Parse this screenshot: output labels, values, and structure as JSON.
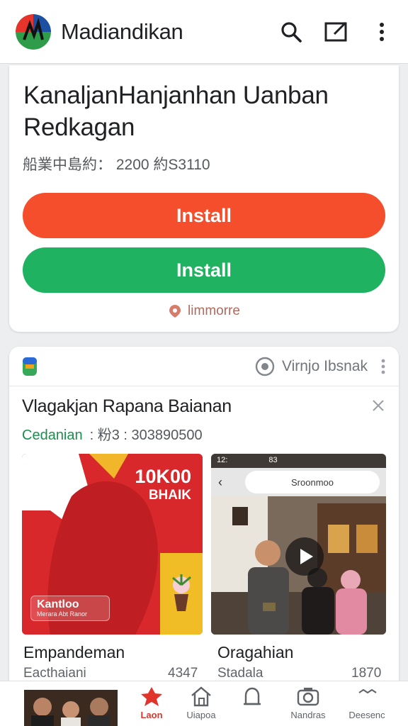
{
  "header": {
    "app_name": "Madiandikan",
    "icons": [
      "app-logo-icon",
      "search-icon",
      "compose-icon",
      "more-vert-icon"
    ]
  },
  "app_card": {
    "title": "KanaljanHanjanhan Uanban Redkagan",
    "meta": "船業中島約： 2200 約S3110",
    "primary_button": "Install",
    "secondary_button": "Install",
    "location_text": "limmorre",
    "colors": {
      "primary": "#f54e2c",
      "secondary": "#1eb261"
    }
  },
  "post_card": {
    "view_label": "Virnjo Ibsnak",
    "title": "Vlagakjan Rapana Baianan",
    "category": "Cedanian",
    "meta": ": 粉3 : 303890500",
    "thumbnails": [
      {
        "headline": "10K00",
        "subline": "BHAIK",
        "badge_title": "Kantloo",
        "badge_sub": "Merara Abt Ranor",
        "caption_title": "Empandeman",
        "caption_sub": "Eacthaiani",
        "caption_num": "4347"
      },
      {
        "status_time": "12:",
        "status_mid": "83",
        "url_text": "Sroonmoo",
        "caption_title": "Oragahian",
        "caption_sub": "Stadala",
        "caption_num": "1870"
      }
    ]
  },
  "bottom_nav": {
    "items": [
      {
        "label": "Laon",
        "icon": "flame-icon",
        "active": true
      },
      {
        "label": "Uiapoa",
        "icon": "home-icon",
        "active": false
      },
      {
        "label": "",
        "icon": "bell-icon",
        "active": false
      },
      {
        "label": "Nandras",
        "icon": "camera-icon",
        "active": false
      },
      {
        "label": "Deesenc",
        "icon": "dots-icon",
        "active": false
      }
    ]
  }
}
